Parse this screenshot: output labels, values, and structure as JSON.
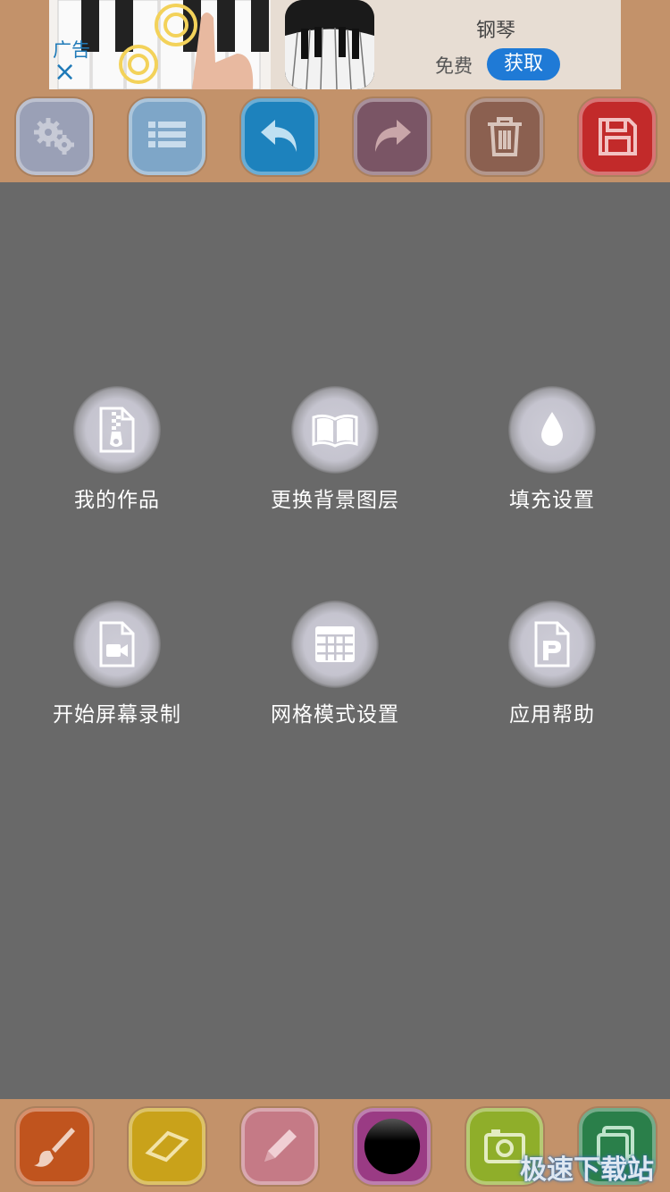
{
  "ad": {
    "label": "广告",
    "close": "×",
    "app_name": "钢琴",
    "price": "免费",
    "get_button": "获取"
  },
  "toolbar": {
    "buttons": [
      {
        "icon": "gears-icon",
        "color": "#9aa0b6"
      },
      {
        "icon": "list-icon",
        "color": "#7ea6c8"
      },
      {
        "icon": "undo-icon",
        "color": "#1d82bd"
      },
      {
        "icon": "redo-icon",
        "color": "#7a5565"
      },
      {
        "icon": "trash-icon",
        "color": "#8b6050"
      },
      {
        "icon": "save-icon",
        "color": "#c22a2a"
      }
    ]
  },
  "menu": {
    "items": [
      {
        "label": "我的作品",
        "icon": "zip-file-icon"
      },
      {
        "label": "更换背景图层",
        "icon": "book-icon"
      },
      {
        "label": "填充设置",
        "icon": "drop-icon"
      },
      {
        "label": "开始屏幕录制",
        "icon": "video-file-icon"
      },
      {
        "label": "网格模式设置",
        "icon": "grid-icon"
      },
      {
        "label": "应用帮助",
        "icon": "p-file-icon"
      }
    ]
  },
  "bottom_toolbar": {
    "buttons": [
      {
        "icon": "brush-icon",
        "color": "#c0541e"
      },
      {
        "icon": "eraser-icon",
        "color": "#c9a21a"
      },
      {
        "icon": "pencil-icon",
        "color": "#c57a86"
      },
      {
        "icon": "color-circle-icon",
        "color": "#9a3b84"
      },
      {
        "icon": "camera-icon",
        "color": "#8fae2a"
      },
      {
        "icon": "layers-icon",
        "color": "#2a7f4a"
      }
    ]
  },
  "watermark": "极速下载站"
}
